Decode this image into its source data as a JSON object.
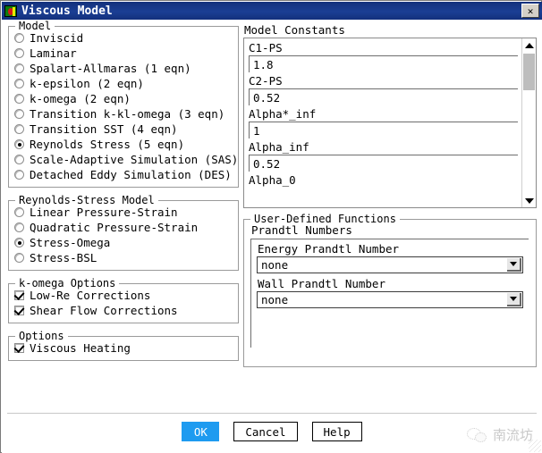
{
  "window": {
    "title": "Viscous Model",
    "icon": "fluent-app-icon",
    "close_label": "✕"
  },
  "model_group": {
    "legend": "Model",
    "selected": "Reynolds Stress (5 eqn)",
    "items": [
      {
        "label": "Inviscid",
        "checked": false
      },
      {
        "label": "Laminar",
        "checked": false
      },
      {
        "label": "Spalart-Allmaras (1 eqn)",
        "checked": false
      },
      {
        "label": "k-epsilon (2 eqn)",
        "checked": false
      },
      {
        "label": "k-omega (2 eqn)",
        "checked": false
      },
      {
        "label": "Transition k-kl-omega (3 eqn)",
        "checked": false
      },
      {
        "label": "Transition SST (4 eqn)",
        "checked": false
      },
      {
        "label": "Reynolds Stress (5 eqn)",
        "checked": true
      },
      {
        "label": "Scale-Adaptive Simulation (SAS)",
        "checked": false
      },
      {
        "label": "Detached Eddy Simulation (DES)",
        "checked": false
      }
    ]
  },
  "rsm_group": {
    "legend": "Reynolds-Stress Model",
    "selected": "Stress-Omega",
    "items": [
      {
        "label": "Linear Pressure-Strain",
        "checked": false
      },
      {
        "label": "Quadratic Pressure-Strain",
        "checked": false
      },
      {
        "label": "Stress-Omega",
        "checked": true
      },
      {
        "label": "Stress-BSL",
        "checked": false
      }
    ]
  },
  "komega_group": {
    "legend": "k-omega Options",
    "items": [
      {
        "label": "Low-Re Corrections",
        "checked": true
      },
      {
        "label": "Shear Flow Corrections",
        "checked": true
      }
    ]
  },
  "options_group": {
    "legend": "Options",
    "items": [
      {
        "label": "Viscous Heating",
        "checked": true
      }
    ]
  },
  "model_constants": {
    "label": "Model Constants",
    "entries": [
      {
        "name": "C1-PS",
        "value": "1.8"
      },
      {
        "name": "C2-PS",
        "value": "0.52"
      },
      {
        "name": "Alpha*_inf",
        "value": "1"
      },
      {
        "name": "Alpha_inf",
        "value": "0.52"
      }
    ],
    "partial_entry": "Alpha_0",
    "scrollbar": {
      "up_arrow": "▲",
      "down_arrow": "▼"
    }
  },
  "udf_group": {
    "legend": "User-Defined Functions",
    "prandtl_label": "Prandtl Numbers",
    "fields": [
      {
        "label": "Energy Prandtl Number",
        "value": "none"
      },
      {
        "label": "Wall Prandtl Number",
        "value": "none"
      }
    ]
  },
  "buttons": {
    "ok": "OK",
    "cancel": "Cancel",
    "help": "Help"
  },
  "watermark": {
    "text": "南流坊"
  },
  "colors": {
    "titlebar": "#16357f",
    "primary_button": "#1e9bf0",
    "group_border": "#9a9a9a",
    "scroll_thumb": "#bdbdbd"
  }
}
